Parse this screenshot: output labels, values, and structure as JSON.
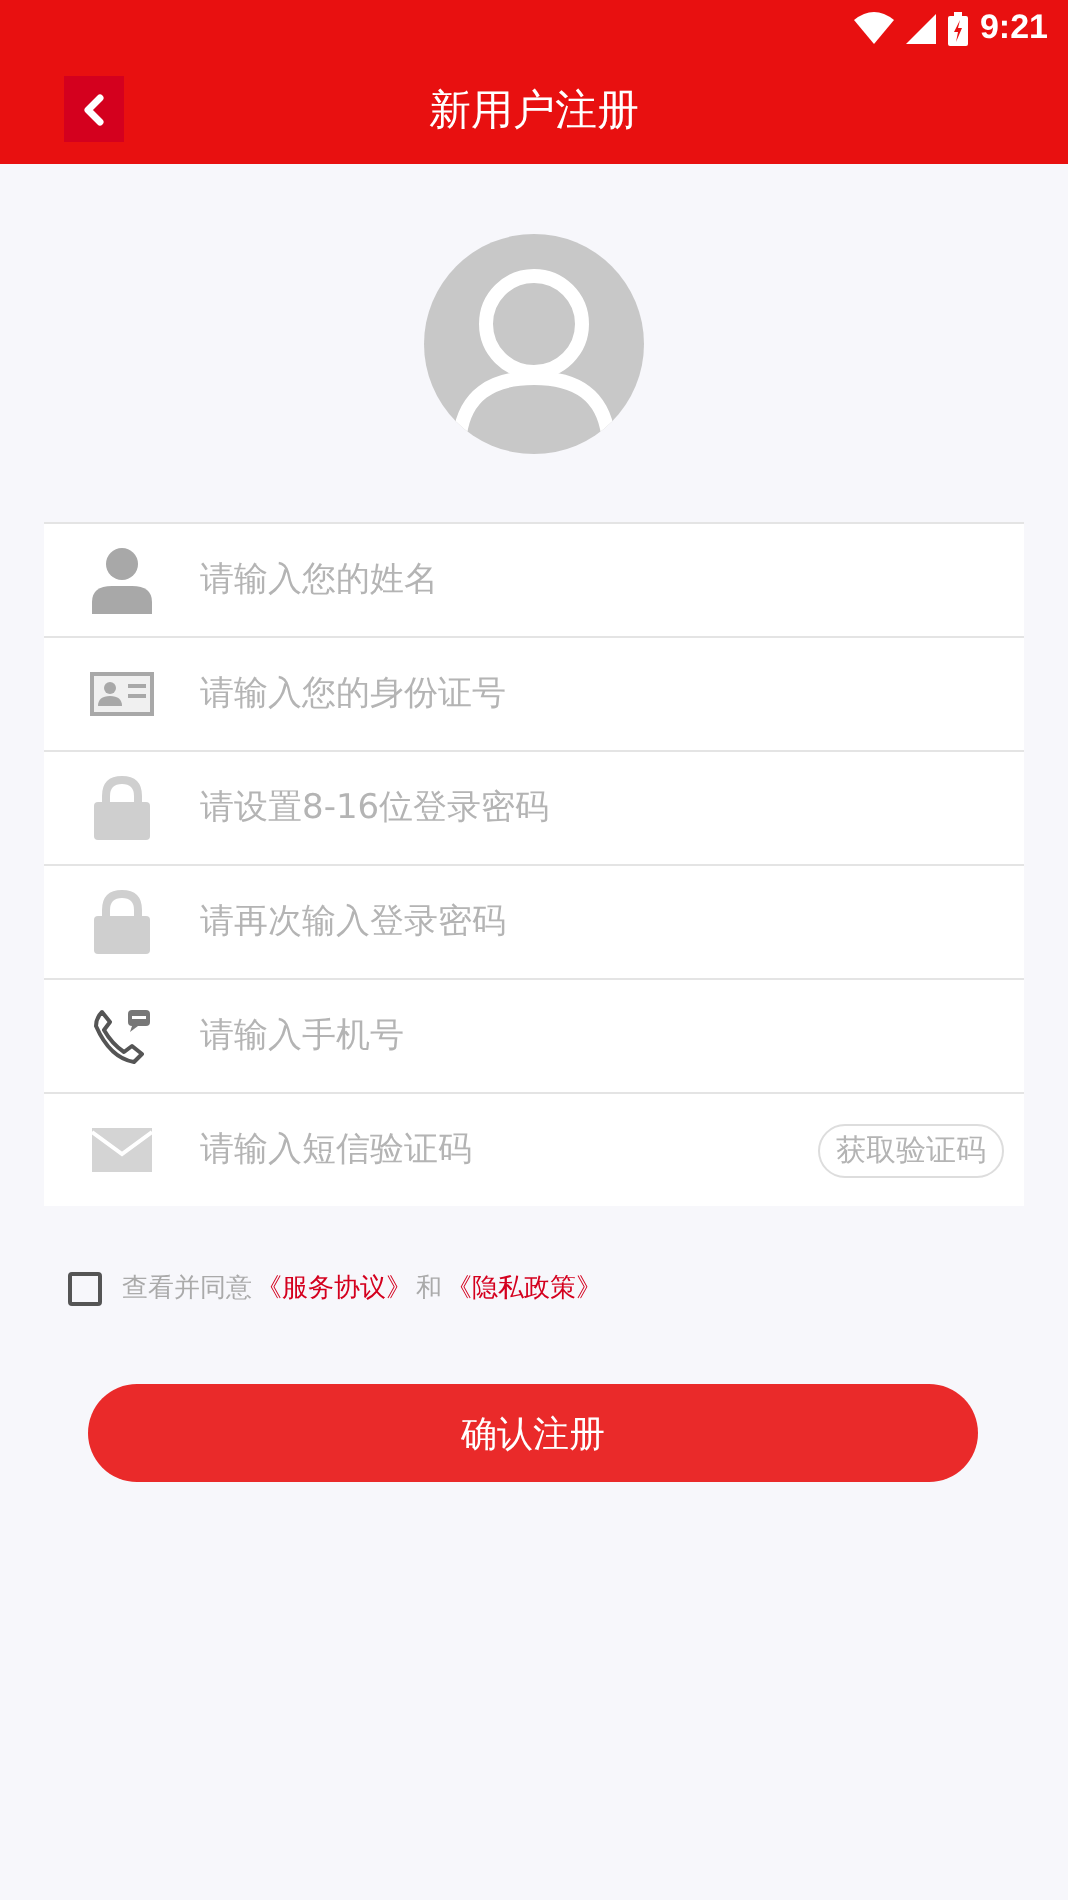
{
  "status_bar": {
    "time": "9:21"
  },
  "header": {
    "title": "新用户注册"
  },
  "fields": [
    {
      "kind": "person",
      "placeholder": "请输入您的姓名"
    },
    {
      "kind": "idcard",
      "placeholder": "请输入您的身份证号"
    },
    {
      "kind": "lock",
      "placeholder": "请设置8-16位登录密码"
    },
    {
      "kind": "lock",
      "placeholder": "请再次输入登录密码"
    },
    {
      "kind": "phone",
      "placeholder": "请输入手机号"
    },
    {
      "kind": "mail",
      "placeholder": "请输入短信验证码",
      "button": "获取验证码"
    }
  ],
  "agreement": {
    "checked": false,
    "parts": [
      {
        "kind": "text",
        "text": "查看并同意"
      },
      {
        "kind": "link",
        "text": "《服务协议》"
      },
      {
        "kind": "text",
        "text": "和"
      },
      {
        "kind": "link",
        "text": "《隐私政策》"
      }
    ]
  },
  "submit": "确认注册"
}
